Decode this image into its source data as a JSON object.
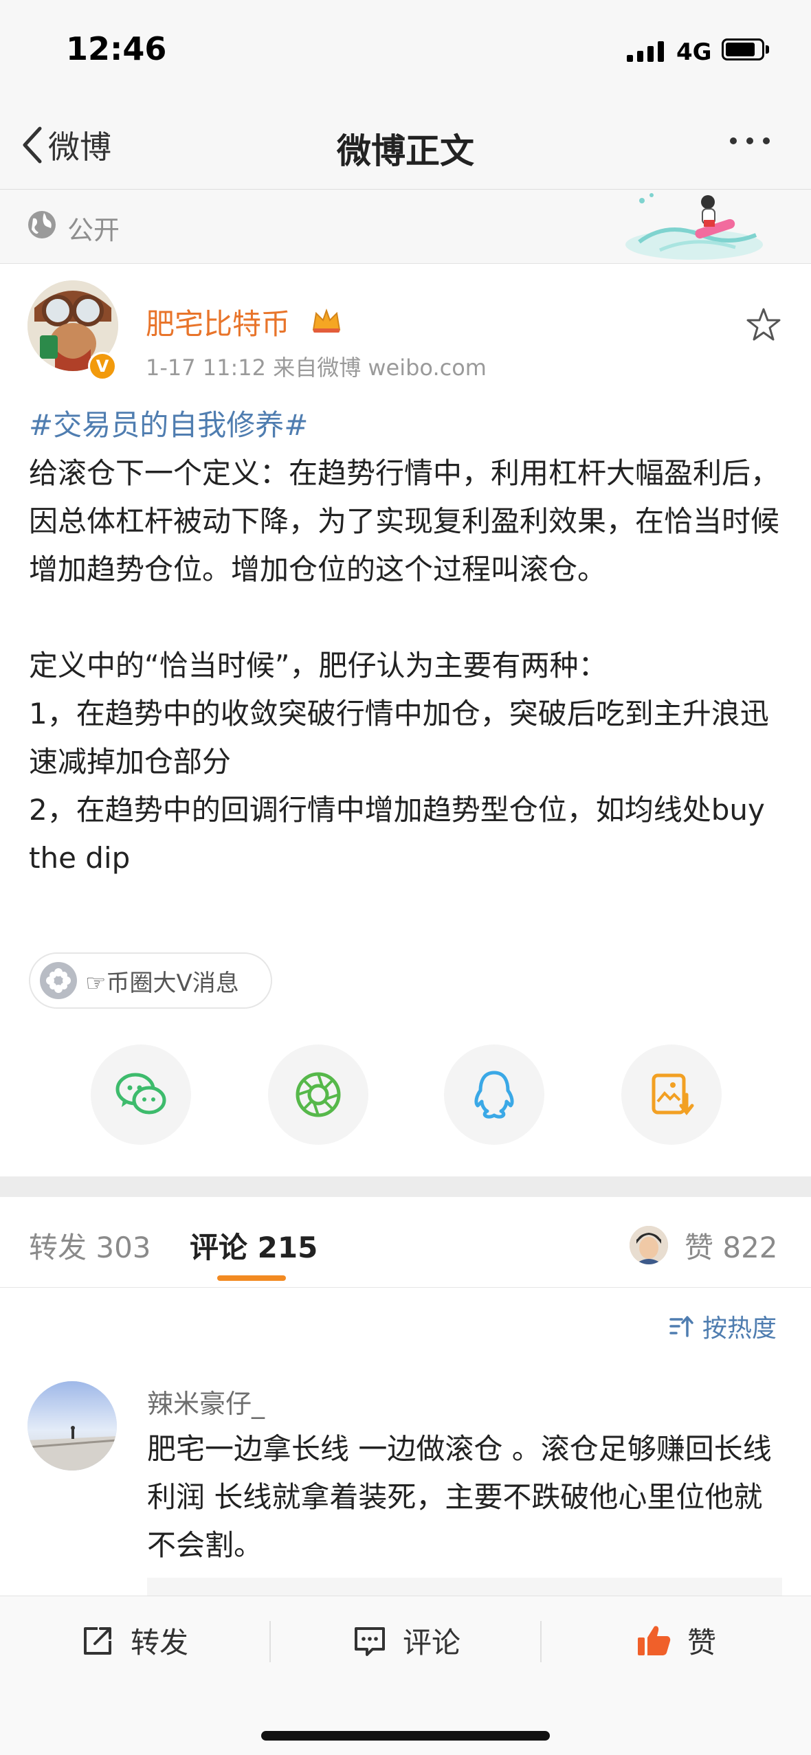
{
  "status_bar": {
    "time": "12:46",
    "network": "4G"
  },
  "nav": {
    "back_label": "微博",
    "title": "微博正文"
  },
  "visibility": {
    "label": "公开"
  },
  "post": {
    "author": "肥宅比特币",
    "meta": "1-17 11:12  来自微博 weibo.com",
    "hashtag": "#交易员的自我修养#",
    "paragraph_1": "给滚仓下一个定义：在趋势行情中，利用杠杆大幅盈利后，因总体杠杆被动下降，为了实现复利盈利效果，在恰当时候增加趋势仓位。增加仓位的这个过程叫滚仓。",
    "paragraph_2": "定义中的“恰当时候”，肥仔认为主要有两种：",
    "point_1": "1，在趋势中的收敛突破行情中加仓，突破后吃到主升浪迅速减掉加仓部分",
    "point_2": "2，在趋势中的回调行情中增加趋势型仓位，如均线处buy the dip",
    "chip_label": "☞币圈大V消息"
  },
  "share_icons": [
    "wechat-icon",
    "moments-icon",
    "qq-icon",
    "save-image-icon"
  ],
  "tabs": {
    "repost": "转发 303",
    "comment": "评论 215",
    "like": "赞 822"
  },
  "sort_label": "按热度",
  "comment": {
    "user": "辣米豪仔_",
    "text": "肥宅一边拿长线 一边做滚仓 。滚仓足够赚回长线利润  长线就拿着装死，主要不跌破他心里位他就不会割。"
  },
  "bottom_bar": {
    "repost": "转发",
    "comment": "评论",
    "like": "赞"
  },
  "colors": {
    "accent": "#f28a22",
    "link": "#4f7db0",
    "author": "#e8742a"
  }
}
